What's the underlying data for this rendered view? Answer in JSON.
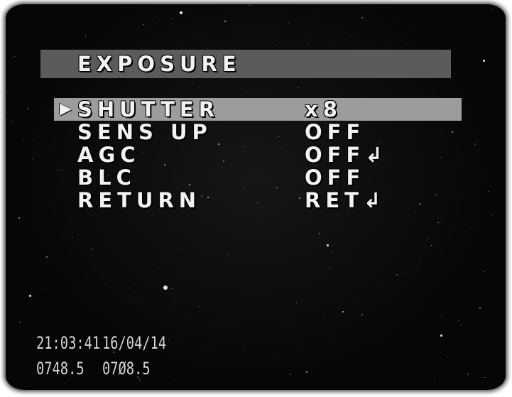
{
  "title": "EXPOSURE",
  "cursor_glyph": "▶",
  "menu": [
    {
      "label": "SHUTTER",
      "value": "x8",
      "selected": true
    },
    {
      "label": "SENS UP",
      "value": "OFF",
      "selected": false
    },
    {
      "label": "AGC",
      "value": "OFF↲",
      "selected": false
    },
    {
      "label": "BLC",
      "value": "OFF",
      "selected": false
    },
    {
      "label": "RETURN",
      "value": "RET↲",
      "selected": false
    }
  ],
  "overlay": {
    "time": "21:03:41",
    "date": "16/04/14",
    "line2_a": "0748.5",
    "line2_b": "07Ø8.5"
  },
  "colors": {
    "background": "#060606",
    "title_bar": "#5b5b5b",
    "selection_bar": "#9c9c9c",
    "text": "#f2f2f2"
  }
}
